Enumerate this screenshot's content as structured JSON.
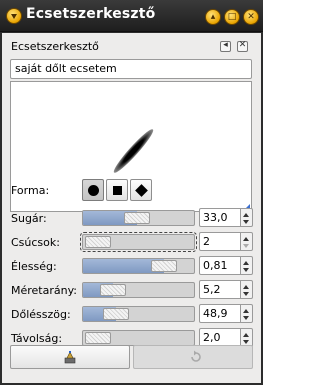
{
  "window": {
    "title": "Ecsetszerkesztő",
    "title_buttons": [
      "shade-icon",
      "maximize-icon",
      "close-icon"
    ]
  },
  "dock": {
    "title": "Ecsetszerkesztő",
    "buttons": [
      "tab-menu-icon",
      "close-dock-icon"
    ]
  },
  "brush": {
    "name_value": "saját dőlt ecsetem"
  },
  "shape": {
    "label": "Forma:",
    "options": [
      "circle",
      "square",
      "diamond"
    ],
    "selected": "circle"
  },
  "params": [
    {
      "label": "Sugár:",
      "value": "33,0",
      "fraction": 0.48
    },
    {
      "label": "Csúcsok:",
      "value": "2",
      "fraction": 0.0
    },
    {
      "label": "Élesség:",
      "value": "0,81",
      "fraction": 0.81
    },
    {
      "label": "Méretarány:",
      "value": "5,2",
      "fraction": 0.18
    },
    {
      "label": "Dőlésszög:",
      "value": "48,9",
      "fraction": 0.22
    },
    {
      "label": "Távolság:",
      "value": "2,0",
      "fraction": 0.0
    }
  ],
  "colors": {
    "title_bg": "#2c2c2c",
    "title_button": "#e9a400",
    "slider_fill": "#7f99c2",
    "panel_bg": "#edeceb"
  }
}
